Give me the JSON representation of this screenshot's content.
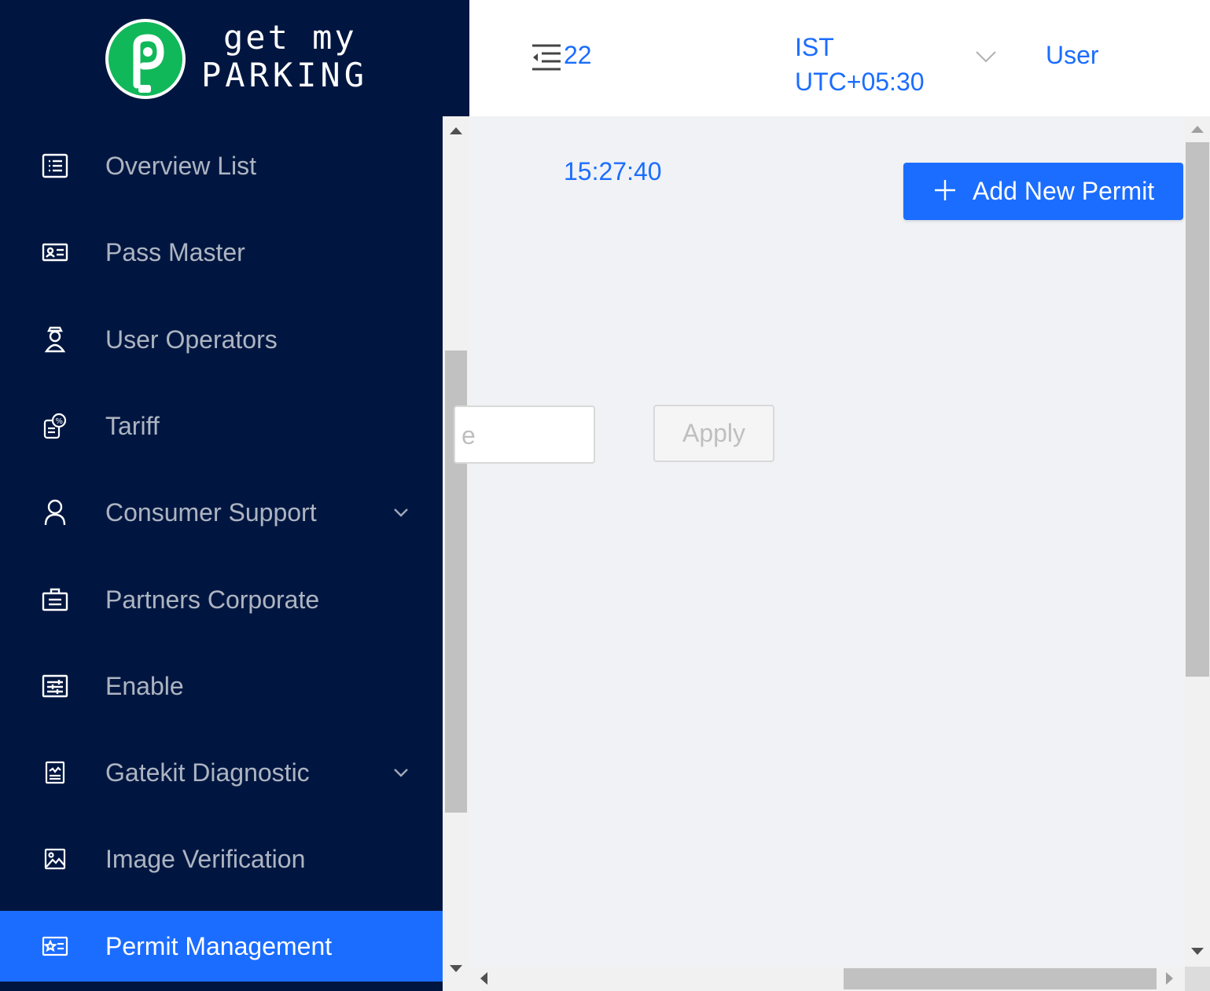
{
  "brand": {
    "line1": "get my",
    "line2": "PARKING",
    "accent_color": "#10b85a"
  },
  "sidebar": {
    "items": [
      {
        "label": "Overview List",
        "icon": "list-icon"
      },
      {
        "label": "Pass Master",
        "icon": "id-card-icon"
      },
      {
        "label": "User Operators",
        "icon": "operator-icon"
      },
      {
        "label": "Tariff",
        "icon": "tariff-icon"
      },
      {
        "label": "Consumer Support",
        "icon": "user-icon",
        "expandable": true
      },
      {
        "label": "Partners Corporate",
        "icon": "briefcase-icon"
      },
      {
        "label": "Enable",
        "icon": "sliders-icon"
      },
      {
        "label": "Gatekit Diagnostic",
        "icon": "diagnostic-icon",
        "expandable": true
      },
      {
        "label": "Image Verification",
        "icon": "image-icon"
      },
      {
        "label": "Permit Management",
        "icon": "permit-icon",
        "active": true
      }
    ]
  },
  "header": {
    "date_fragment": "22",
    "timezone_name": "IST",
    "timezone_offset": "UTC+05:30",
    "user_label": "User"
  },
  "main": {
    "clock": "15:27:40",
    "add_button_label": "Add New Permit",
    "filter_input_visible_text": "e",
    "apply_button_label": "Apply"
  },
  "colors": {
    "sidebar_bg": "#001640",
    "primary": "#1b6dff",
    "content_bg": "#f0f2f5"
  }
}
